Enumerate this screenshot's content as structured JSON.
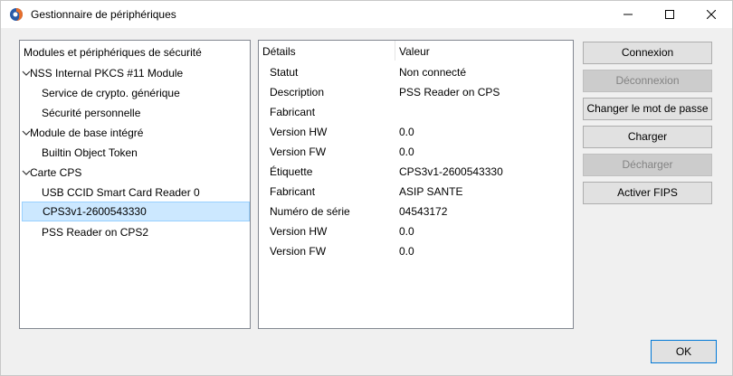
{
  "window": {
    "title": "Gestionnaire de périphériques"
  },
  "tree": {
    "header": "Modules et périphériques de sécurité",
    "rows": [
      {
        "label": "NSS Internal PKCS #11 Module",
        "level": 0
      },
      {
        "label": "Service de crypto. générique",
        "level": 1
      },
      {
        "label": "Sécurité personnelle",
        "level": 1
      },
      {
        "label": "Module de base intégré",
        "level": 0
      },
      {
        "label": "Builtin Object Token",
        "level": 1
      },
      {
        "label": "Carte CPS",
        "level": 0
      },
      {
        "label": "USB CCID Smart Card Reader 0",
        "level": 1
      },
      {
        "label": "CPS3v1-2600543330",
        "level": 1,
        "selected": true
      },
      {
        "label": "PSS Reader on CPS2",
        "level": 1
      }
    ]
  },
  "details": {
    "col_details": "Détails",
    "col_value": "Valeur",
    "rows": [
      {
        "key": "Statut",
        "value": "Non connecté"
      },
      {
        "key": "Description",
        "value": "PSS Reader on CPS"
      },
      {
        "key": "Fabricant",
        "value": ""
      },
      {
        "key": "Version HW",
        "value": "0.0"
      },
      {
        "key": "Version FW",
        "value": "0.0"
      },
      {
        "key": "Étiquette",
        "value": "CPS3v1-2600543330"
      },
      {
        "key": "Fabricant",
        "value": "ASIP SANTE"
      },
      {
        "key": "Numéro de série",
        "value": "04543172"
      },
      {
        "key": "Version HW",
        "value": "0.0"
      },
      {
        "key": "Version FW",
        "value": "0.0"
      }
    ]
  },
  "buttons": {
    "connexion": "Connexion",
    "deconnexion": "Déconnexion",
    "changer_mdp": "Changer le mot de passe",
    "charger": "Charger",
    "decharger": "Décharger",
    "activer_fips": "Activer FIPS",
    "ok": "OK"
  },
  "colors": {
    "selection": "#cce8ff",
    "ok_border": "#0078d7"
  }
}
